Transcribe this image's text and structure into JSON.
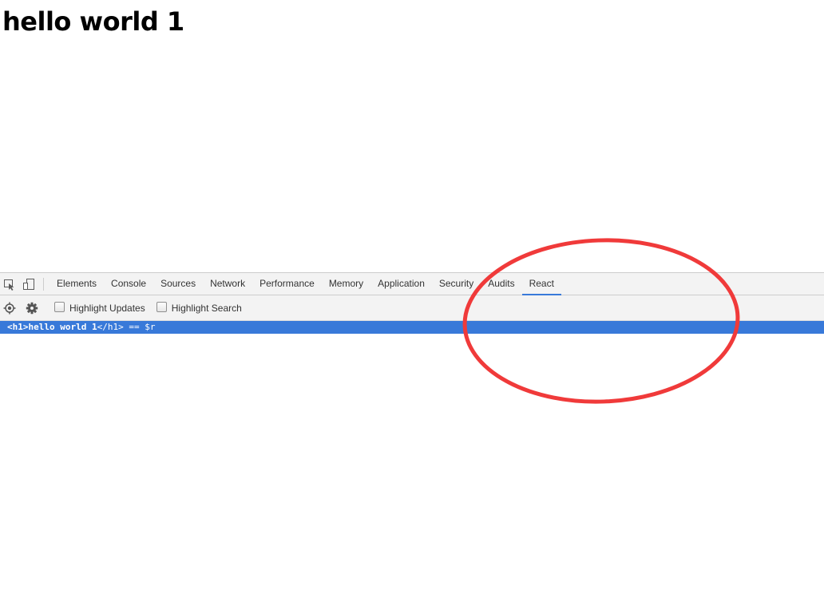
{
  "page": {
    "heading": "hello world 1"
  },
  "devtools": {
    "tool_icons": [
      "inspect-element-icon",
      "device-toggle-icon"
    ],
    "tabs": [
      {
        "label": "Elements"
      },
      {
        "label": "Console"
      },
      {
        "label": "Sources"
      },
      {
        "label": "Network"
      },
      {
        "label": "Performance"
      },
      {
        "label": "Memory"
      },
      {
        "label": "Application"
      },
      {
        "label": "Security"
      },
      {
        "label": "Audits"
      },
      {
        "label": "React",
        "active": true
      }
    ],
    "react_toolbar": {
      "icons": [
        "target-icon",
        "gear-icon"
      ],
      "highlight_updates_label": "Highlight Updates",
      "highlight_updates_checked": false,
      "highlight_search_label": "Highlight Search",
      "highlight_search_checked": false
    },
    "tree": {
      "selected_row": {
        "open_tag": "<h1>",
        "text": "hello world 1",
        "close_tag": "</h1>",
        "suffix": " == $r"
      }
    }
  },
  "colors": {
    "accent": "#3879d9",
    "annotation_circle": "#f03a3a",
    "panel_bg": "#f3f3f3"
  }
}
